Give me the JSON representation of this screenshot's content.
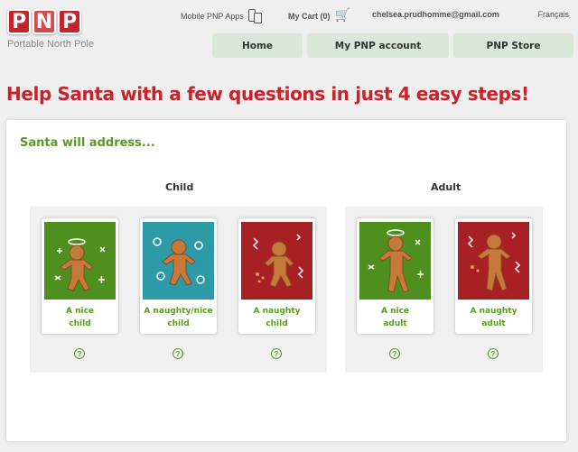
{
  "logo": {
    "letters": [
      "P",
      "N",
      "P"
    ],
    "subtitle": "Portable North Pole"
  },
  "topbar": {
    "mobile_apps": "Mobile PNP Apps",
    "cart": "My Cart (0)",
    "email": "chelsea.prudhomme@gmail.com",
    "language": "Français"
  },
  "nav": {
    "home": "Home",
    "account": "My PNP account",
    "store": "PNP Store"
  },
  "headline": "Help Santa with a few questions in just 4 easy steps!",
  "panel": {
    "title": "Santa will address...",
    "child_label": "Child",
    "adult_label": "Adult",
    "child_options": [
      {
        "line1": "A nice",
        "line2": "child",
        "bg": "#4f8f1d"
      },
      {
        "line1": "A naughty/nice",
        "line2": "child",
        "bg": "#2d9aa8"
      },
      {
        "line1": "A naughty",
        "line2": "child",
        "bg": "#a81f24"
      }
    ],
    "adult_options": [
      {
        "line1": "A nice",
        "line2": "adult",
        "bg": "#4f8f1d"
      },
      {
        "line1": "A naughty",
        "line2": "adult",
        "bg": "#a81f24"
      }
    ],
    "help_symbol": "?"
  },
  "colors": {
    "brand_red": "#c8222a",
    "accent_green": "#5a9a22",
    "nav_bg": "#d9e8d8"
  }
}
